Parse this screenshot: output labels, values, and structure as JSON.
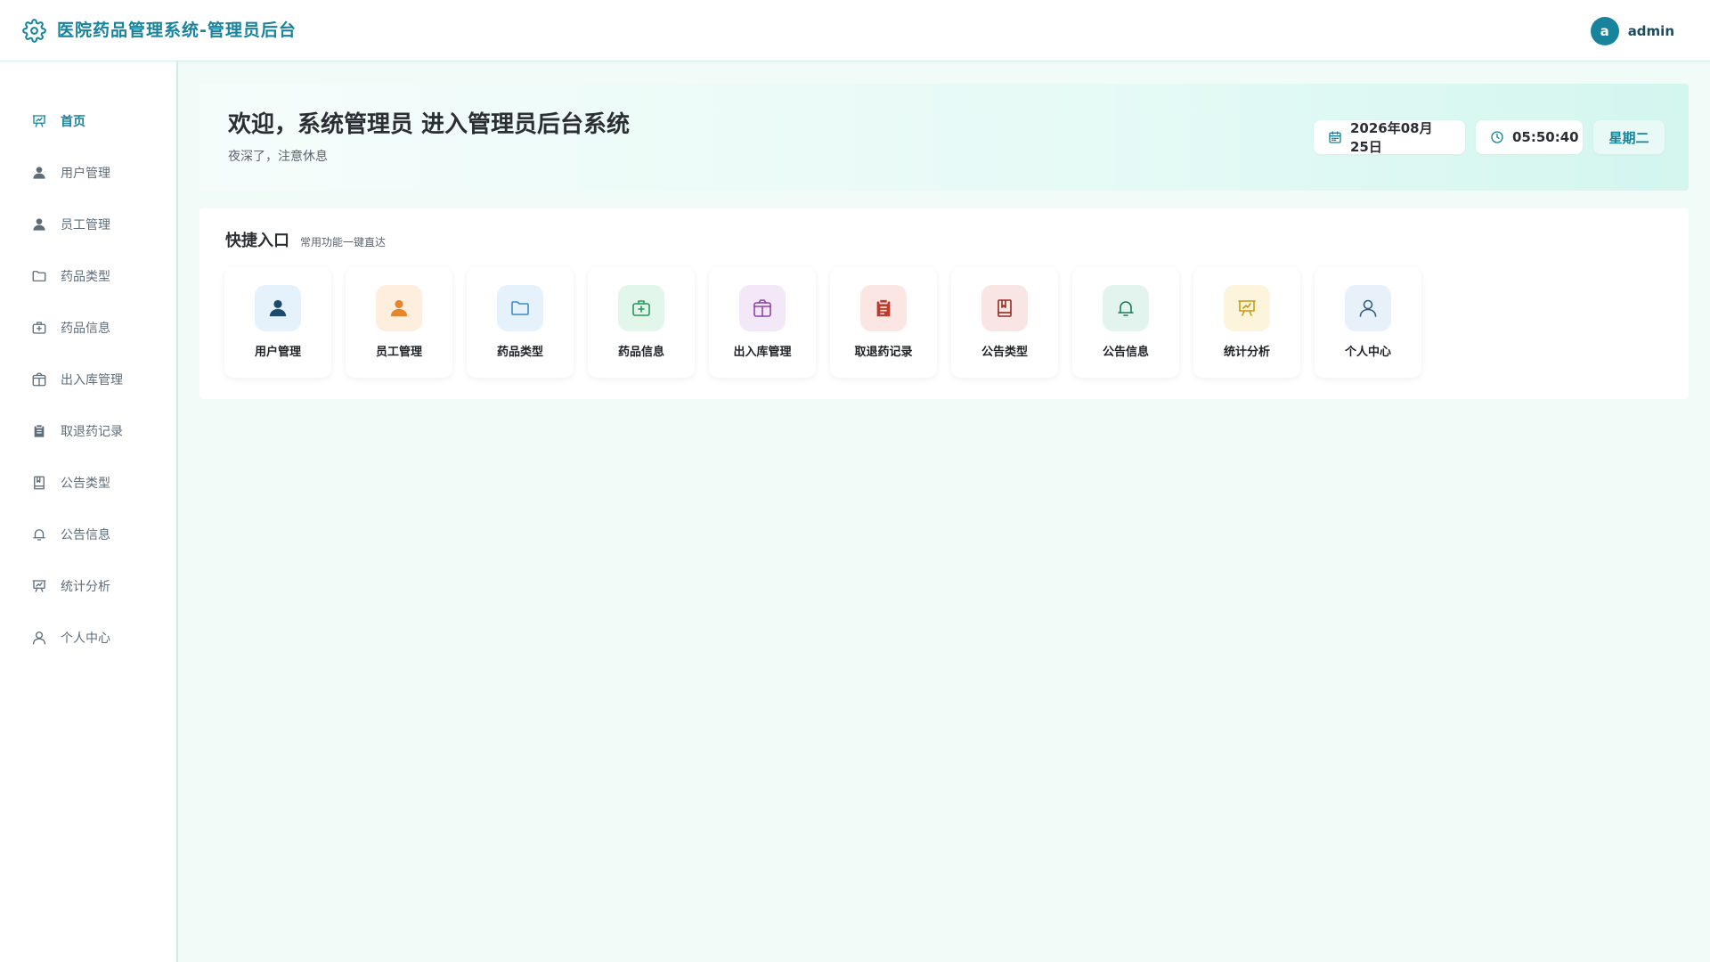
{
  "header": {
    "title": "医院药品管理系统-管理员后台",
    "logo_icon": "gear-icon",
    "user": {
      "avatar_letter": "a",
      "name": "admin"
    }
  },
  "colors": {
    "accent": "#17839c",
    "page_bg": "#f1fbf8",
    "sidebar_text": "#5e6d7a"
  },
  "sidebar": {
    "items": [
      {
        "label": "首页",
        "icon": "presentation-chart-icon",
        "active": true
      },
      {
        "label": "用户管理",
        "icon": "user-filled-icon",
        "active": false
      },
      {
        "label": "员工管理",
        "icon": "user-filled-icon",
        "active": false
      },
      {
        "label": "药品类型",
        "icon": "folder-icon",
        "active": false
      },
      {
        "label": "药品信息",
        "icon": "first-aid-kit-icon",
        "active": false
      },
      {
        "label": "出入库管理",
        "icon": "box-icon",
        "active": false
      },
      {
        "label": "取退药记录",
        "icon": "clipboard-icon",
        "active": false
      },
      {
        "label": "公告类型",
        "icon": "book-icon",
        "active": false
      },
      {
        "label": "公告信息",
        "icon": "bell-icon",
        "active": false
      },
      {
        "label": "统计分析",
        "icon": "presentation-chart-icon",
        "active": false
      },
      {
        "label": "个人中心",
        "icon": "user-outline-icon",
        "active": false
      }
    ]
  },
  "welcome": {
    "title": "欢迎，系统管理员 进入管理员后台系统",
    "subtitle": "夜深了，注意休息",
    "date": "2026年08月25日",
    "time": "05:50:40",
    "weekday": "星期二"
  },
  "quick": {
    "title": "快捷入口",
    "subtitle": "常用功能一键直达",
    "items": [
      {
        "label": "用户管理",
        "icon": "user-filled-icon",
        "bg": "#e6f2fb",
        "color": "#1d4b6e"
      },
      {
        "label": "员工管理",
        "icon": "user-filled-icon",
        "bg": "#fdeedd",
        "color": "#e4862c"
      },
      {
        "label": "药品类型",
        "icon": "folder-icon",
        "bg": "#e6f2fb",
        "color": "#3c8dc4"
      },
      {
        "label": "药品信息",
        "icon": "first-aid-kit-icon",
        "bg": "#e3f6ec",
        "color": "#239a57"
      },
      {
        "label": "出入库管理",
        "icon": "box-icon",
        "bg": "#f3e8f7",
        "color": "#8e44ad"
      },
      {
        "label": "取退药记录",
        "icon": "clipboard-icon",
        "bg": "#fbe6e4",
        "color": "#c0392b"
      },
      {
        "label": "公告类型",
        "icon": "book-icon",
        "bg": "#f9e6e4",
        "color": "#922b21"
      },
      {
        "label": "公告信息",
        "icon": "bell-icon",
        "bg": "#e3f4ef",
        "color": "#1e7a5f"
      },
      {
        "label": "统计分析",
        "icon": "presentation-chart-icon",
        "bg": "#fdf4dc",
        "color": "#c99a12"
      },
      {
        "label": "个人中心",
        "icon": "user-outline-icon",
        "bg": "#e8f1fa",
        "color": "#2f5f84"
      }
    ]
  }
}
